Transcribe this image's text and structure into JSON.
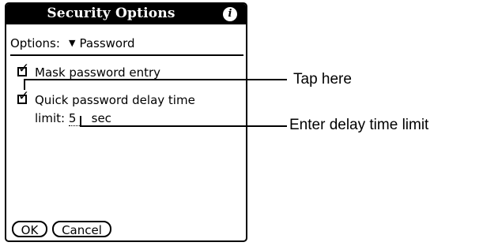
{
  "dialog": {
    "title": "Security Options",
    "info_icon": "info-icon",
    "options_label": "Options:",
    "options_selected": "Password",
    "mask_label": "Mask password entry",
    "mask_checked": true,
    "quick_label": "Quick password delay time",
    "quick_checked": true,
    "limit_label": "limit:",
    "limit_value": "5",
    "limit_unit": "sec",
    "ok_label": "OK",
    "cancel_label": "Cancel"
  },
  "callouts": {
    "tap_here": "Tap here",
    "enter_delay": "Enter delay time limit"
  }
}
